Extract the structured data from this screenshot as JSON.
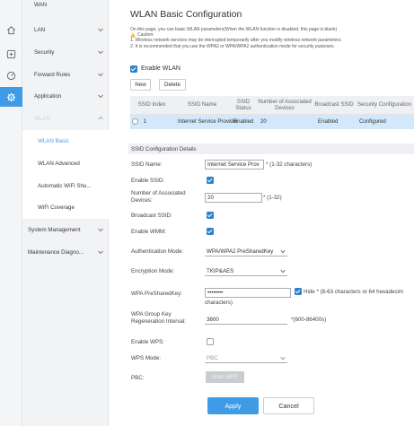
{
  "rail": {
    "icons": [
      "home-icon",
      "plus-box-icon",
      "gauge-icon",
      "gear-icon"
    ],
    "active_index": 3,
    "active_color": "#3f9be6"
  },
  "nav": {
    "top_item": "WAN",
    "items": [
      {
        "label": "LAN"
      },
      {
        "label": "Security"
      },
      {
        "label": "Forward Rules"
      },
      {
        "label": "Application"
      },
      {
        "label": "WLAN"
      }
    ],
    "sub_items": [
      {
        "label": "WLAN Basic"
      },
      {
        "label": "WLAN Advanced"
      },
      {
        "label": "Automatic WiFi Shu..."
      },
      {
        "label": "WiFi Coverage"
      }
    ],
    "bottom_items": [
      {
        "label": "System Management"
      },
      {
        "label": "Maintenance Diagno..."
      }
    ]
  },
  "page": {
    "title": "WLAN Basic Configuration",
    "intro": "On this page, you can basic WLAN parameters(When the WLAN function is disabled, this page is blank)",
    "caution_label": "Caution:",
    "caution_1": "1. Wireless network services may be interrupted temporarily after you modify wireless network parameters.",
    "caution_2": "2. It is recommended that you use the WPA2 or WPA/WPA2 authentication mode for security purposes.",
    "enable_wlan_label": "Enable WLAN",
    "new_button": "New",
    "delete_button": "Delete"
  },
  "ssid_table": {
    "headers": [
      "SSID Index",
      "SSID Name",
      "SSID Status",
      "Number of Associated Devices",
      "Broadcast SSID",
      "Security Configuration"
    ],
    "rows": [
      {
        "index": "1",
        "name": "Internet Service Provider",
        "status": "Enabled",
        "devices": "20",
        "broadcast": "Enabled",
        "security": "Configured"
      }
    ]
  },
  "details": {
    "section_title": "SSID Configuration Details",
    "ssid_name_label": "SSID Name:",
    "ssid_name_value": "Internet Service Prov",
    "ssid_name_hint": "* (1-32 characters)",
    "enable_ssid_label": "Enable SSID:",
    "enable_ssid": true,
    "assoc_label": "Number of Associated Devices:",
    "assoc_value": "20",
    "assoc_hint": "* (1-32)",
    "broadcast_label": "Broadcast SSID:",
    "broadcast": true,
    "wmm_label": "Enable WMM:",
    "wmm": true,
    "auth_label": "Authentication Mode:",
    "auth_value": "WPA/WPA2 PreSharedKey",
    "enc_label": "Encryption Mode:",
    "enc_value": "TKIP&AES",
    "psk_label": "WPA PreSharedKey:",
    "psk_value": "••••••••",
    "psk_hide": true,
    "psk_hint": "Hide * (8-63 characters or 64 hexadecim",
    "psk_hint2": "characters)",
    "rekey_label": "WPA Group Key Regeneration Interval:",
    "rekey_value": "3600",
    "rekey_hint": "*(600-86400s)",
    "wps_label": "Enable WPS:",
    "wps": false,
    "wps_mode_label": "WPS Mode:",
    "wps_mode_value": "PBC",
    "pbc_label": "PBC:",
    "start_wps": "Start WPS",
    "apply": "Apply",
    "cancel": "Cancel"
  }
}
